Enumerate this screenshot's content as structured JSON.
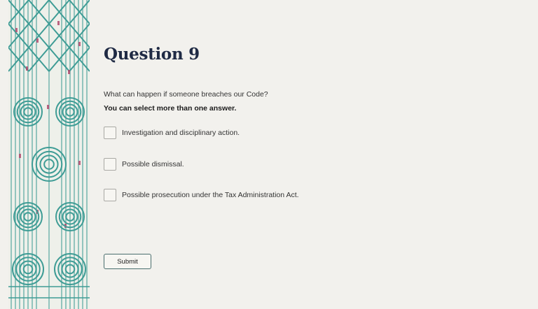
{
  "question": {
    "title": "Question 9",
    "text": "What can happen if someone breaches our Code?",
    "hint": "You can select more than one answer.",
    "options": [
      {
        "label": "Investigation and disciplinary action.",
        "checked": false
      },
      {
        "label": "Possible dismissal.",
        "checked": false
      },
      {
        "label": "Possible prosecution under the Tax Administration Act.",
        "checked": false
      }
    ]
  },
  "submit": {
    "label": "Submit"
  },
  "decor": {
    "primary_color": "#3e9c95",
    "accent_color": "#b24a6f",
    "background_color": "#eef0ea"
  }
}
